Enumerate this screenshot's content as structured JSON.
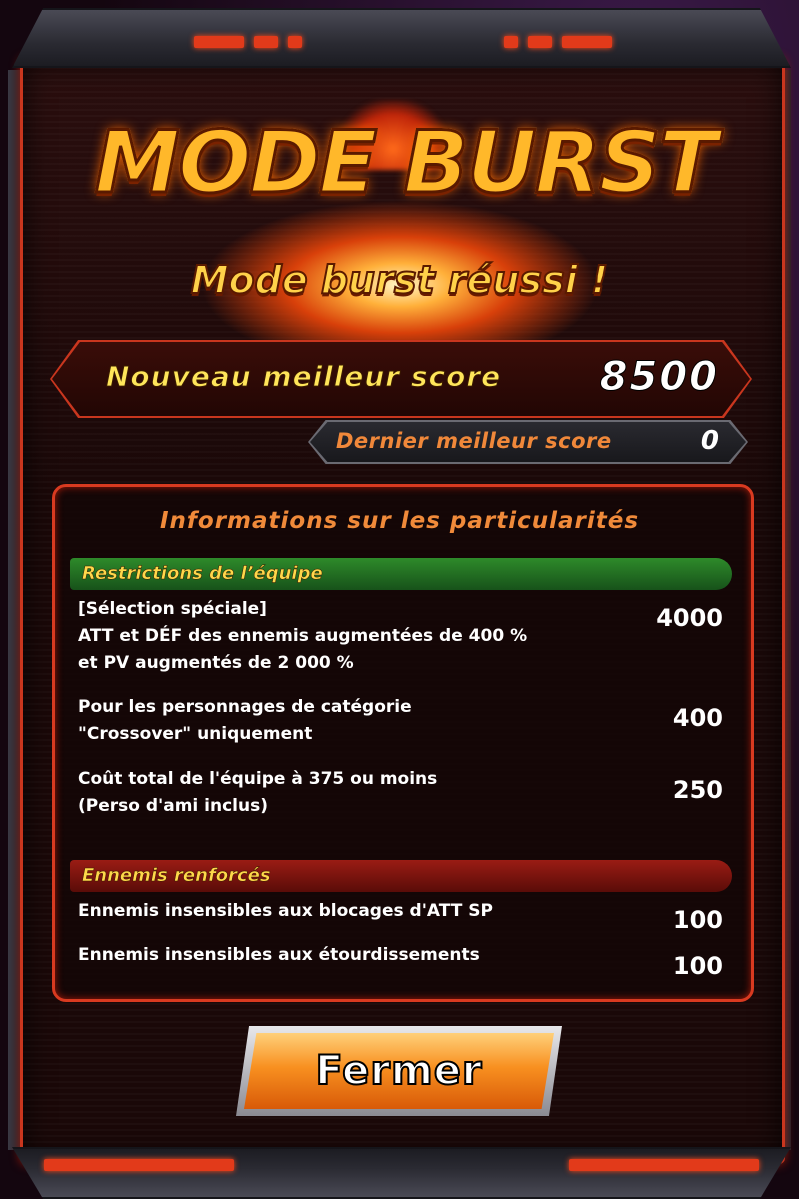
{
  "header": {
    "logo_text": "MODE BURST"
  },
  "result": {
    "status": "Mode burst réussi !"
  },
  "scores": {
    "new_best_label": "Nouveau meilleur score",
    "new_best_value": "8500",
    "last_best_label": "Dernier meilleur score",
    "last_best_value": "0"
  },
  "info": {
    "title": "Informations sur les particularités",
    "categories": [
      {
        "label": "Restrictions de l’équipe",
        "color": "#2e8a2a",
        "rows": [
          {
            "lines": [
              "[Sélection spéciale]",
              "ATT et DÉF des ennemis augmentées de 400 %",
              "et PV augmentés de 2 000 %"
            ],
            "points": "4000"
          },
          {
            "lines": [
              "Pour les personnages de catégorie",
              "\"Crossover\" uniquement"
            ],
            "points": "400"
          },
          {
            "lines": [
              "Coût total de l'équipe à 375 ou moins",
              "(Perso d'ami inclus)"
            ],
            "points": "250"
          }
        ]
      },
      {
        "label": "Ennemis renforcés",
        "color": "#9a1c14",
        "rows": [
          {
            "lines": [
              "Ennemis insensibles aux blocages d'ATT SP"
            ],
            "points": "100"
          },
          {
            "lines": [
              "Ennemis insensibles aux étourdissements"
            ],
            "points": "100"
          }
        ]
      }
    ]
  },
  "actions": {
    "close_label": "Fermer"
  },
  "colors": {
    "frame_accent": "#c9361e",
    "title_gold": "#ffb82a"
  }
}
